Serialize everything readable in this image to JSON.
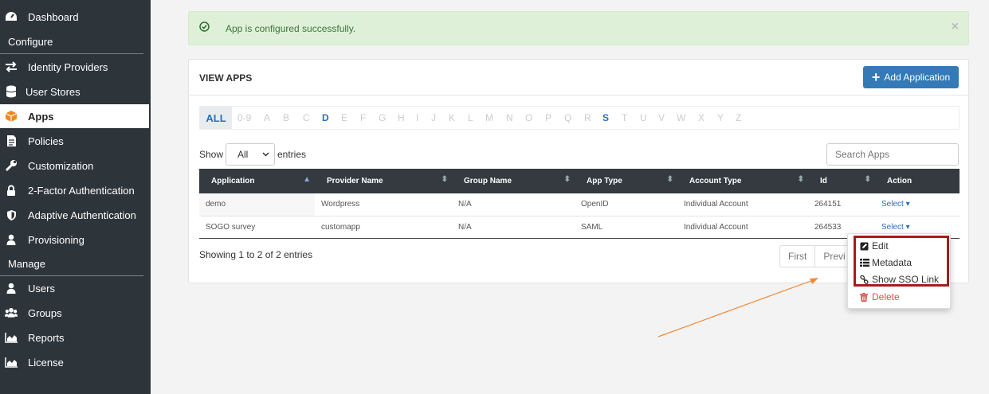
{
  "sidebar": {
    "dashboard": "Dashboard",
    "configure_heading": "Configure",
    "identity_providers": "Identity Providers",
    "user_stores": "User Stores",
    "apps": "Apps",
    "policies": "Policies",
    "customization": "Customization",
    "two_factor": "2-Factor Authentication",
    "adaptive": "Adaptive Authentication",
    "provisioning": "Provisioning",
    "manage_heading": "Manage",
    "users": "Users",
    "groups": "Groups",
    "reports": "Reports",
    "license": "License"
  },
  "alert": {
    "message": "App is configured successfully.",
    "close": "×"
  },
  "panel": {
    "title": "VIEW APPS",
    "add_button": "Add Application"
  },
  "alphabet": {
    "all": "ALL",
    "letters": [
      "0-9",
      "A",
      "B",
      "C",
      "D",
      "E",
      "F",
      "G",
      "H",
      "I",
      "J",
      "K",
      "L",
      "M",
      "N",
      "O",
      "P",
      "Q",
      "R",
      "S",
      "T",
      "U",
      "V",
      "W",
      "X",
      "Y",
      "Z"
    ],
    "active": [
      "D",
      "S"
    ]
  },
  "controls": {
    "show_label": "Show",
    "show_value": "All",
    "entries_label": "entries",
    "search_placeholder": "Search Apps"
  },
  "table": {
    "headers": [
      "Application",
      "Provider Name",
      "Group Name",
      "App Type",
      "Account Type",
      "Id",
      "Action"
    ],
    "rows": [
      [
        "demo",
        "Wordpress",
        "N/A",
        "OpenID",
        "Individual Account",
        "264151",
        "Select"
      ],
      [
        "SOGO survey",
        "customapp",
        "N/A",
        "SAML",
        "Individual Account",
        "264533",
        "Select"
      ]
    ]
  },
  "footer": {
    "showing": "Showing 1 to 2 of 2 entries",
    "pager": [
      "First",
      "Previ"
    ]
  },
  "dropdown": {
    "edit": "Edit",
    "metadata": "Metadata",
    "show_sso": "Show SSO Link",
    "delete": "Delete"
  },
  "colors": {
    "sidebar_bg": "#2d353b",
    "accent": "#337ab7",
    "alert_bg": "#dff0d8",
    "table_header": "#343a40",
    "highlight": "#a61c1c",
    "arrow": "#f08a3a",
    "delete": "#d9534f"
  }
}
